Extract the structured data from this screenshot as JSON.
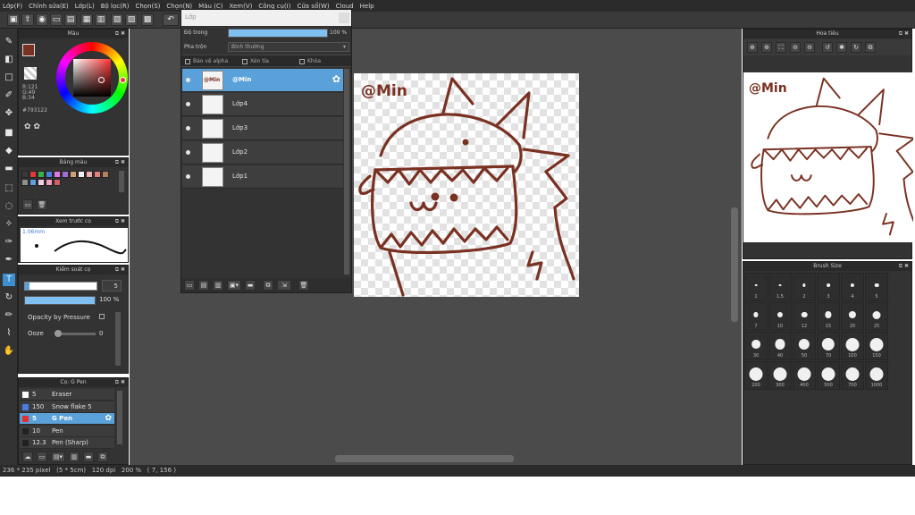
{
  "menu": [
    "Lớp(F)",
    "Chỉnh sửa(E)",
    "Lớp(L)",
    "Bộ lọc(R)",
    "Chọn(S)",
    "Chọn(N)",
    "Màu (C)",
    "Xem(V)",
    "Công cụ(I)",
    "Cửa sổ(W)",
    "Cloud",
    "Help"
  ],
  "color_panel": {
    "title": "Màu",
    "r": "R:121",
    "g": "G:49",
    "b": "B:34",
    "hex": "#793122",
    "fg_color": "#793122",
    "bg_color": "#ffffff"
  },
  "palette_panel": {
    "title": "Bảng màu",
    "swatches": [
      "#3a3a3a",
      "#e03a3a",
      "#3ab04a",
      "#4a7de0",
      "#e07ae0",
      "#a070d0",
      "#d0a070",
      "#f0f0f0",
      "#f0b0b0",
      "#e08080",
      "#b08060",
      "#909090",
      "#60a0e0",
      "#f0d0e0",
      "#f0a0c0",
      "#d06060"
    ]
  },
  "preview_panel": {
    "title": "Xem trước cọ",
    "size": "1.06mm"
  },
  "brush_control": {
    "title": "Kiểm soát cọ",
    "size_value": "5",
    "opacity_value": "100 %",
    "opacity_fraction": 1.0,
    "opacity_by_pressure": "Opacity by Pressure",
    "ooze_label": "Ooze",
    "ooze_value": "0"
  },
  "brush_list": {
    "title": "Cọ: G Pen",
    "items": [
      {
        "size": "5",
        "name": "Eraser",
        "color": "#ffffff",
        "selected": false
      },
      {
        "size": "150",
        "name": "Snow flake 5",
        "color": "#4a7de0",
        "selected": false
      },
      {
        "size": "5",
        "name": "G Pen",
        "color": "#e03030",
        "selected": true
      },
      {
        "size": "10",
        "name": "Pen",
        "color": "#222222",
        "selected": false
      },
      {
        "size": "12.3",
        "name": "Pen (Sharp)",
        "color": "#222222",
        "selected": false
      }
    ]
  },
  "layer_panel": {
    "title": "Lớp",
    "opacity_label": "Độ trong",
    "opacity_value": "100 %",
    "opacity_fraction": 1.0,
    "blend_label": "Pha trộn",
    "blend_value": "Bình thường",
    "check_alpha": "Bảo vệ alpha",
    "check_clip": "Xén tỉa",
    "check_lock": "Khóa",
    "layers": [
      {
        "name": "@Min",
        "selected": true,
        "thumb": "@Min"
      },
      {
        "name": "Lớp4",
        "selected": false,
        "thumb": ""
      },
      {
        "name": "Lớp3",
        "selected": false,
        "thumb": ""
      },
      {
        "name": "Lớp2",
        "selected": false,
        "thumb": ""
      },
      {
        "name": "Lớp1",
        "selected": false,
        "thumb": ""
      }
    ]
  },
  "canvas": {
    "text": "@Min",
    "ink": "#793122"
  },
  "navigator": {
    "title": "Hoa tiêu",
    "text": "@Min"
  },
  "brush_size_panel": {
    "title": "Brush Size",
    "sizes": [
      "1",
      "1.5",
      "2",
      "3",
      "4",
      "5",
      "7",
      "10",
      "12",
      "15",
      "20",
      "25",
      "30",
      "40",
      "50",
      "70",
      "100",
      "150",
      "200",
      "300",
      "400",
      "500",
      "700",
      "1000"
    ]
  },
  "status": "236 * 235 pixel   (5 * 5cm)   120 dpi   200 %   ( 7, 156 )"
}
